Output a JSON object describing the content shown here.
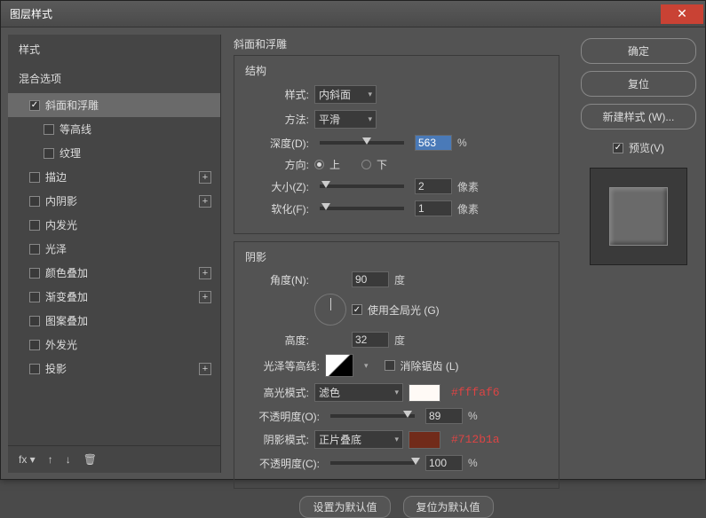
{
  "window": {
    "title": "图层样式"
  },
  "sidebar": {
    "styles_label": "样式",
    "blend_label": "混合选项",
    "items": [
      {
        "label": "斜面和浮雕",
        "checked": true,
        "selected": true,
        "plus": false
      },
      {
        "label": "等高线",
        "checked": false,
        "sub": true,
        "plus": false
      },
      {
        "label": "纹理",
        "checked": false,
        "sub": true,
        "plus": false
      },
      {
        "label": "描边",
        "checked": false,
        "plus": true
      },
      {
        "label": "内阴影",
        "checked": false,
        "plus": true
      },
      {
        "label": "内发光",
        "checked": false,
        "plus": false
      },
      {
        "label": "光泽",
        "checked": false,
        "plus": false
      },
      {
        "label": "颜色叠加",
        "checked": false,
        "plus": true
      },
      {
        "label": "渐变叠加",
        "checked": false,
        "plus": true
      },
      {
        "label": "图案叠加",
        "checked": false,
        "plus": false
      },
      {
        "label": "外发光",
        "checked": false,
        "plus": false
      },
      {
        "label": "投影",
        "checked": false,
        "plus": true
      }
    ],
    "fx_label": "fx"
  },
  "main": {
    "title": "斜面和浮雕",
    "structure": {
      "label": "结构",
      "style_label": "样式:",
      "style_value": "内斜面",
      "technique_label": "方法:",
      "technique_value": "平滑",
      "depth_label": "深度(D):",
      "depth_value": "563",
      "depth_unit": "%",
      "direction_label": "方向:",
      "up_label": "上",
      "down_label": "下",
      "size_label": "大小(Z):",
      "size_value": "2",
      "size_unit": "像素",
      "soften_label": "软化(F):",
      "soften_value": "1",
      "soften_unit": "像素"
    },
    "shading": {
      "label": "阴影",
      "angle_label": "角度(N):",
      "angle_value": "90",
      "angle_unit": "度",
      "global_label": "使用全局光 (G)",
      "altitude_label": "高度:",
      "altitude_value": "32",
      "altitude_unit": "度",
      "gloss_label": "光泽等高线:",
      "anti_label": "消除锯齿 (L)",
      "highlight_mode_label": "高光模式:",
      "highlight_mode_value": "滤色",
      "highlight_color": "#fffaf6",
      "highlight_color_text": "#fffaf6",
      "highlight_opacity_label": "不透明度(O):",
      "highlight_opacity_value": "89",
      "highlight_opacity_unit": "%",
      "shadow_mode_label": "阴影模式:",
      "shadow_mode_value": "正片叠底",
      "shadow_color": "#712b1a",
      "shadow_color_text": "#712b1a",
      "shadow_opacity_label": "不透明度(C):",
      "shadow_opacity_value": "100",
      "shadow_opacity_unit": "%"
    },
    "defaults": {
      "set": "设置为默认值",
      "reset": "复位为默认值"
    }
  },
  "right": {
    "ok": "确定",
    "cancel": "复位",
    "new_style": "新建样式 (W)...",
    "preview_label": "预览(V)"
  }
}
